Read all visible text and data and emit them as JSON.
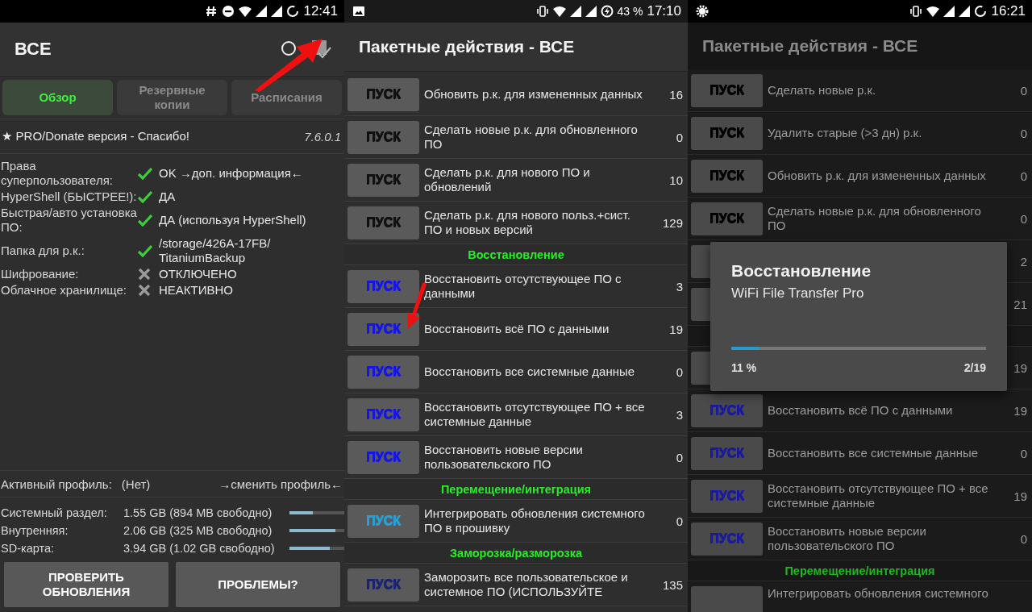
{
  "overview_screen": {
    "status_bar": {
      "time": "12:41"
    },
    "title": "ВСЕ",
    "tabs": [
      {
        "label": "Обзор",
        "selected": true
      },
      {
        "label": "Резервные копии",
        "selected": false
      },
      {
        "label": "Расписания",
        "selected": false
      }
    ],
    "pro_banner": {
      "text": "★ PRO/Donate версия - Спасибо!",
      "version": "7.6.0.1"
    },
    "status_rows": [
      {
        "label": "Права суперпользователя:",
        "value": "OK →доп. информация←",
        "ok": true
      },
      {
        "label": "HyperShell (БЫСТРЕЕ!):",
        "value": "ДА",
        "ok": true
      },
      {
        "label": "Быстрая/авто установка ПО:",
        "value": "ДА (используя HyperShell)",
        "ok": true
      },
      {
        "label": "Папка для р.к.:",
        "value": "/storage/426A-17FB/ TitaniumBackup",
        "ok": true
      },
      {
        "label": "Шифрование:",
        "value": "ОТКЛЮЧЕНО",
        "ok": false
      },
      {
        "label": "Облачное хранилище:",
        "value": "НЕАКТИВНО",
        "ok": false
      }
    ],
    "profile": {
      "label": "Активный профиль:",
      "value": "(Нет)",
      "link": "→сменить профиль←"
    },
    "storage": [
      {
        "label": "Системный раздел:",
        "value": "1.55 GB (894 MB свободно)",
        "level": 0.43
      },
      {
        "label": "Внутренняя:",
        "value": "2.06 GB (325 MB свободно)",
        "level": 0.84
      },
      {
        "label": "SD-карта:",
        "value": "3.94 GB (1.02 GB свободно)",
        "level": 0.74
      }
    ],
    "buttons": [
      "ПРОВЕРИТЬ ОБНОВЛЕНИЯ",
      "ПРОБЛЕМЫ?"
    ]
  },
  "batch_screen": {
    "status_bar": {
      "battery": "43 %",
      "time": "17:10"
    },
    "title": "Пакетные действия - ВСЕ",
    "items": [
      {
        "kind": "action",
        "button": "ПУСК",
        "label": "Обновить р.к. для измененных данных",
        "count": "16"
      },
      {
        "kind": "action",
        "button": "ПУСК",
        "label": "Сделать новые р.к. для обновленного ПО",
        "count": "0"
      },
      {
        "kind": "action",
        "button": "ПУСК",
        "label": "Сделать р.к. для нового ПО и обновлений",
        "count": "10"
      },
      {
        "kind": "action",
        "button": "ПУСК",
        "label": "Сделать р.к. для нового польз.+сист. ПО и новых версий",
        "count": "129"
      },
      {
        "kind": "section",
        "label": "Восстановление"
      },
      {
        "kind": "action",
        "button": "ПУСК",
        "label": "Восстановить отсутствующее ПО с данными",
        "count": "3"
      },
      {
        "kind": "action",
        "button": "ПУСК",
        "label": "Восстановить всё ПО с данными",
        "count": "19"
      },
      {
        "kind": "action",
        "button": "ПУСК",
        "label": "Восстановить все системные данные",
        "count": "0"
      },
      {
        "kind": "action",
        "button": "ПУСК",
        "label": "Восстановить отсутствующее ПО + все системные данные",
        "count": "3"
      },
      {
        "kind": "action",
        "button": "ПУСК",
        "label": "Восстановить новые версии пользовательского ПО",
        "count": "0"
      },
      {
        "kind": "section",
        "label": "Перемещение/интеграция"
      },
      {
        "kind": "action",
        "button": "ПУСК",
        "label": "Интегрировать обновления системного ПО в прошивку",
        "count": "0"
      },
      {
        "kind": "section",
        "label": "Заморозка/разморозка"
      },
      {
        "kind": "action",
        "button": "ПУСК",
        "label": "Заморозить все пользовательское и системное ПО (ИСПОЛЬЗУЙТЕ",
        "count": "135"
      }
    ]
  },
  "progress_screen": {
    "status_bar": {
      "time": "16:21"
    },
    "title": "Пакетные действия - ВСЕ",
    "items": [
      {
        "kind": "action",
        "button": "ПУСК",
        "label": "Сделать новые р.к.",
        "count": "0"
      },
      {
        "kind": "action",
        "button": "ПУСК",
        "label": "Удалить старые (>3 дн) р.к.",
        "count": "0"
      },
      {
        "kind": "action",
        "button": "ПУСК",
        "label": "Обновить р.к. для измененных данных",
        "count": "0"
      },
      {
        "kind": "action",
        "button": "ПУСК",
        "label": "Сделать новые р.к. для обновленного ПО",
        "count": "0"
      },
      {
        "kind": "action",
        "count": "2"
      },
      {
        "kind": "action",
        "count": "21"
      },
      {
        "kind": "section"
      },
      {
        "kind": "action",
        "count": "19"
      },
      {
        "kind": "action",
        "button": "ПУСК",
        "label": "Восстановить всё ПО с данными",
        "count": "19"
      },
      {
        "kind": "action",
        "button": "ПУСК",
        "label": "Восстановить все системные данные",
        "count": "0"
      },
      {
        "kind": "action",
        "button": "ПУСК",
        "label": "Восстановить отсутствующее ПО + все системные данные",
        "count": "19"
      },
      {
        "kind": "action",
        "button": "ПУСК",
        "label": "Восстановить новые версии пользовательского ПО",
        "count": "0"
      },
      {
        "kind": "section",
        "label": "Перемещение/интеграция"
      },
      {
        "kind": "action",
        "label": "Интегрировать обновления системного"
      }
    ],
    "dialog": {
      "title": "Восстановление",
      "subtitle": "WiFi File Transfer Pro",
      "level": 0.11,
      "percent": "11 %",
      "progress": "2/19"
    }
  }
}
